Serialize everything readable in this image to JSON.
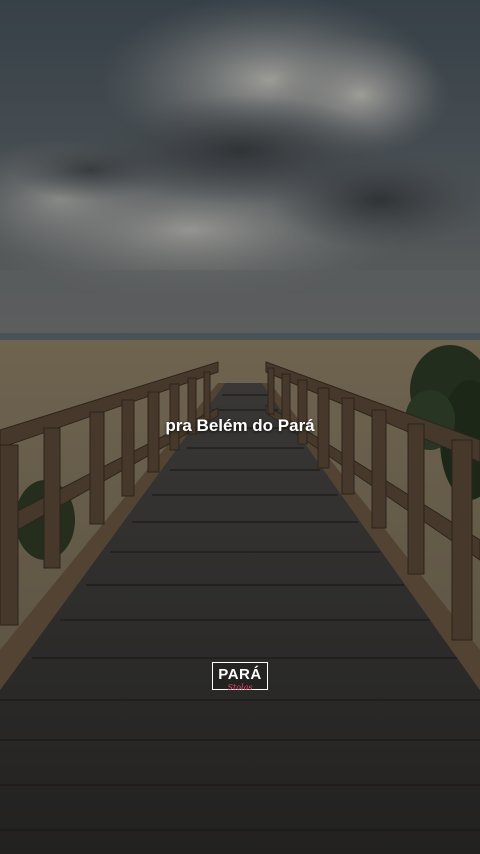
{
  "video": {
    "caption": "pra Belém do Pará"
  },
  "logo": {
    "main": "PARÁ",
    "sub": "Stolas"
  }
}
